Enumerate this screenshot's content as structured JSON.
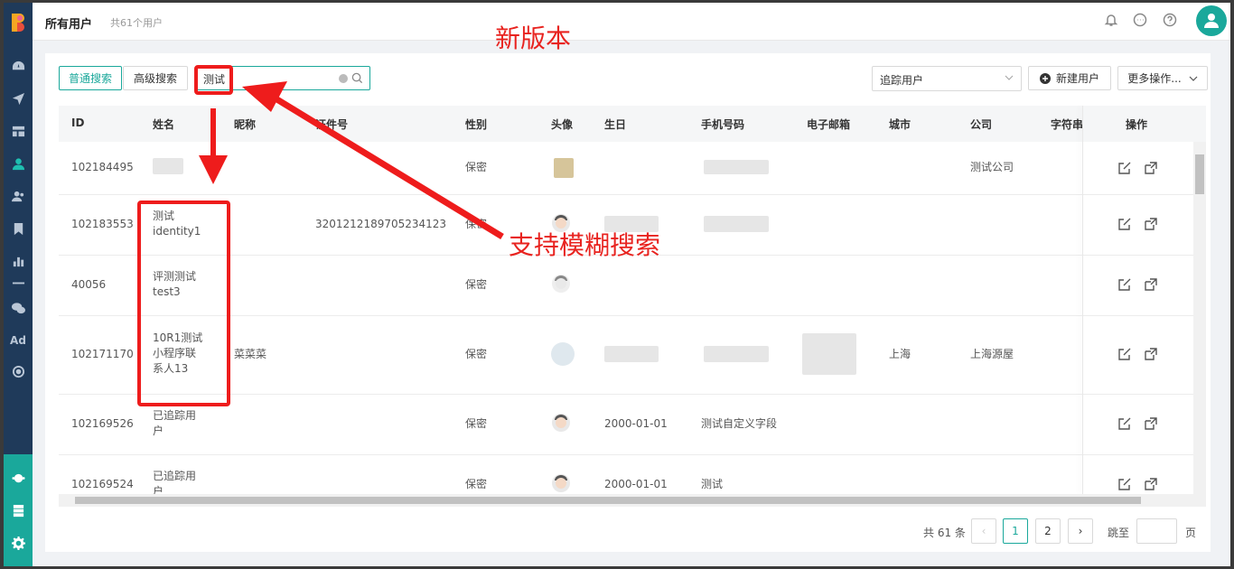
{
  "header": {
    "title": "所有用户",
    "count": "共61个用户"
  },
  "search": {
    "normal_tab": "普通搜索",
    "advanced_tab": "高级搜索",
    "value": "测试"
  },
  "toolbar": {
    "track_select": "追踪用户",
    "new_user": "新建用户",
    "more_actions": "更多操作..."
  },
  "table": {
    "columns": [
      "ID",
      "姓名",
      "昵称",
      "证件号",
      "性别",
      "头像",
      "生日",
      "手机号码",
      "电子邮箱",
      "城市",
      "公司",
      "字符串",
      "操作"
    ],
    "rows": [
      {
        "id": "102184495",
        "name": "",
        "nickname": "",
        "cert": "",
        "gender": "保密",
        "birthday": "",
        "phone": "",
        "city": "",
        "company": "测试公司"
      },
      {
        "id": "102183553",
        "name": "测试\nidentity1",
        "nickname": "",
        "cert": "320121218970523412 3",
        "gender": "保密",
        "birthday": "",
        "phone": "",
        "city": "",
        "company": ""
      },
      {
        "id": "40056",
        "name": "评测测试\ntest3",
        "nickname": "",
        "cert": "",
        "gender": "保密",
        "birthday": "",
        "phone": "",
        "city": "",
        "company": ""
      },
      {
        "id": "102171170",
        "name": "10R1测试\n小程序联\n系人13",
        "nickname": "菜菜菜",
        "cert": "",
        "gender": "保密",
        "birthday": "",
        "phone": "",
        "city": "上海",
        "company": "上海源屋"
      },
      {
        "id": "102169526",
        "name": "已追踪用\n户",
        "nickname": "",
        "cert": "",
        "gender": "保密",
        "birthday": "2000-01-01",
        "phone": "测试自定义字段",
        "city": "",
        "company": ""
      },
      {
        "id": "102169524",
        "name": "已追踪用\n户",
        "nickname": "",
        "cert": "",
        "gender": "保密",
        "birthday": "2000-01-01",
        "phone": "测试",
        "city": "",
        "company": ""
      }
    ]
  },
  "pagination": {
    "total": "共 61 条",
    "pages": [
      "1",
      "2"
    ],
    "prev": "‹",
    "next": "›",
    "jump_label": "跳至",
    "page_label": "页"
  },
  "annotations": {
    "new_version": "新版本",
    "fuzzy_search": "支持模糊搜索"
  },
  "colors": {
    "accent": "#1aa89b",
    "sidebar": "#1f3a5a",
    "annotation": "#e8231f"
  },
  "icons": [
    "dashboard-icon",
    "send-icon",
    "layout-icon",
    "user-icon",
    "users-icon",
    "bookmark-icon",
    "bar-chart-icon",
    "minus-icon",
    "wechat-icon",
    "ad-icon",
    "target-icon",
    "robot-icon",
    "server-icon",
    "gear-icon",
    "bell-icon",
    "chat-icon",
    "help-icon",
    "avatar-icon",
    "edit-icon",
    "export-icon"
  ]
}
